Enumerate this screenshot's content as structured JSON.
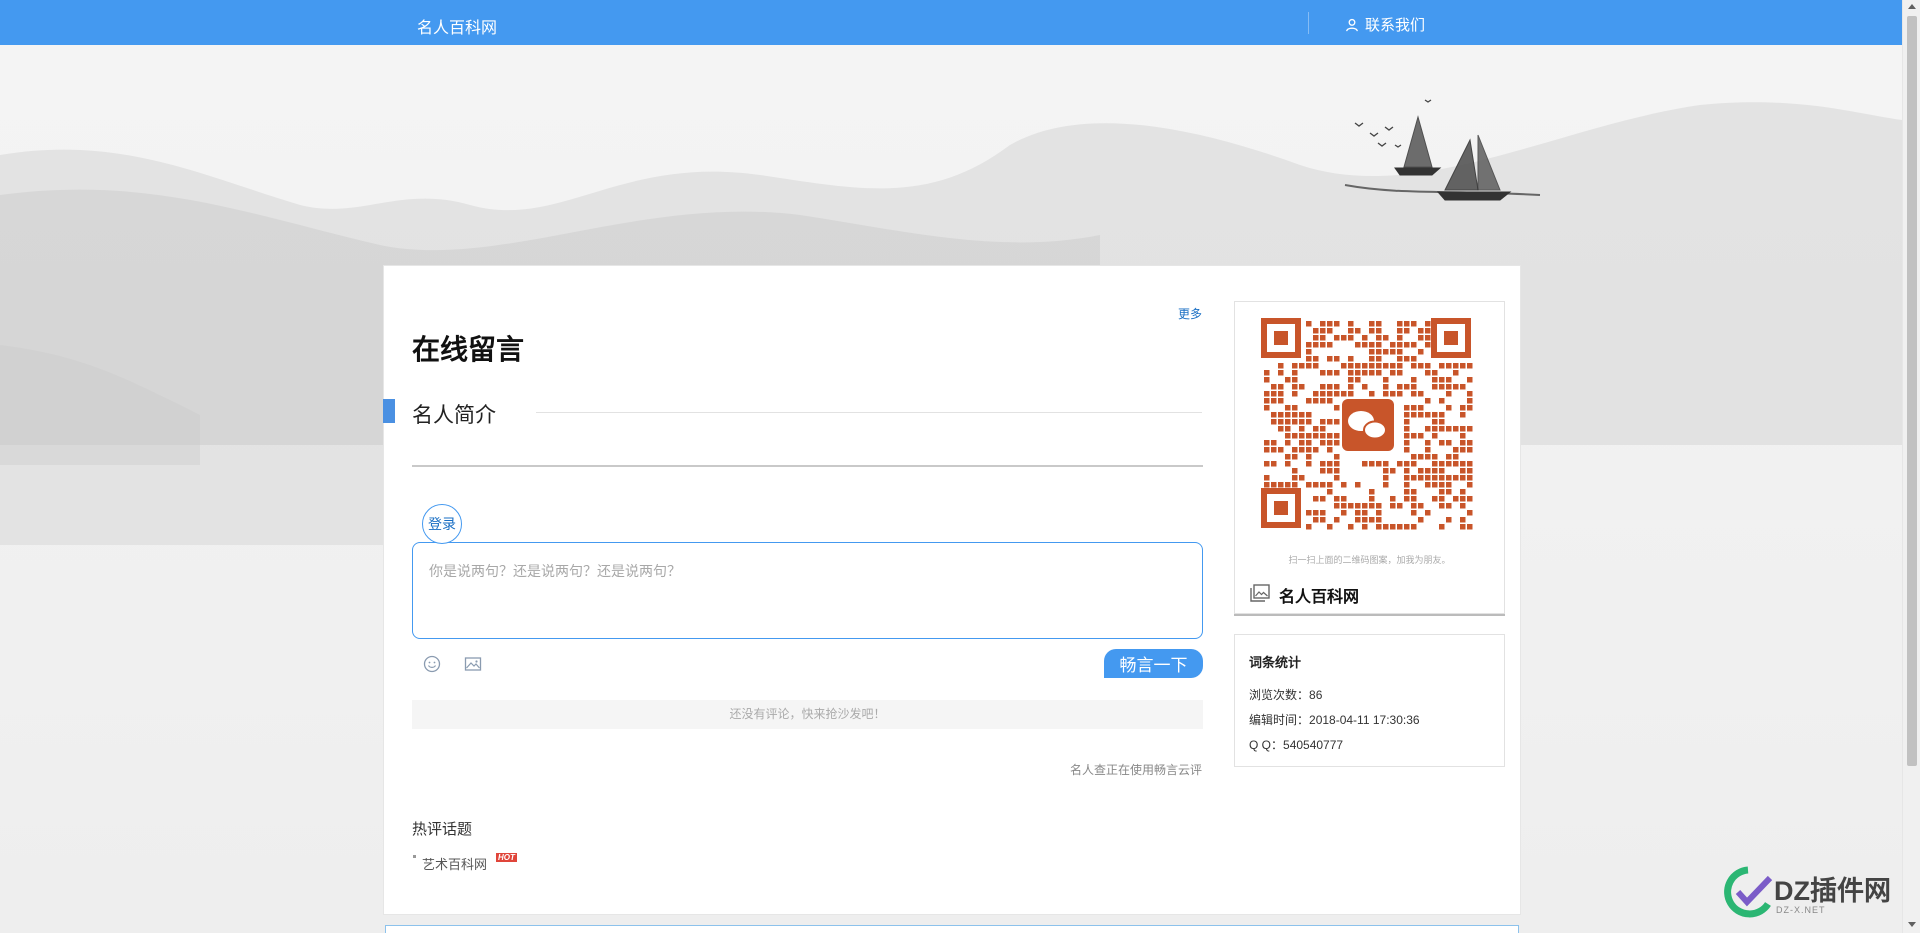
{
  "nav": {
    "brand": "名人百科网",
    "contact": "联系我们"
  },
  "main": {
    "more": "更多",
    "title": "在线留言",
    "intro_title": "名人简介",
    "comment": {
      "login": "登录",
      "placeholder": "你是说两句？还是说两句？还是说两句？",
      "submit": "畅言一下",
      "empty": "还没有评论，快来抢沙发吧！",
      "powered": "名人查正在使用畅言云评"
    },
    "hot": {
      "heading": "热评话题",
      "item": "艺术百科网",
      "badge": "HOT"
    }
  },
  "sidebar": {
    "qr_caption": "扫一扫上面的二维码图案，加我为朋友。",
    "site_name": "名人百科网",
    "stats": {
      "title": "词条统计",
      "views_label": "浏览次数：",
      "views": "86",
      "edit_label": "编辑时间：",
      "edit_time": "2018-04-11 17:30:36",
      "qq_label": "Q Q：",
      "qq": "540540777"
    }
  },
  "watermark": {
    "text": "DZ插件网",
    "sub": "DZ-X.NET"
  },
  "colors": {
    "nav": "#4499f0",
    "qr": "#c8552a",
    "link": "#1a6fc4"
  }
}
